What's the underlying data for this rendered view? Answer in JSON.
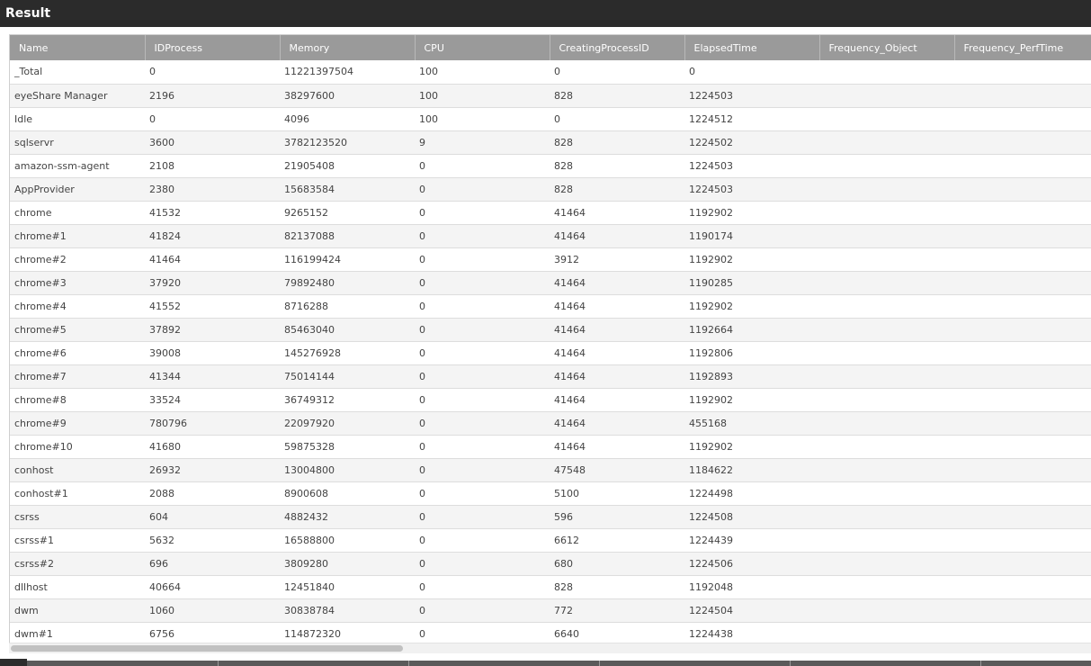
{
  "window": {
    "title": "Result"
  },
  "table": {
    "columns": [
      "Name",
      "IDProcess",
      "Memory",
      "CPU",
      "CreatingProcessID",
      "ElapsedTime",
      "Frequency_Object",
      "Frequency_PerfTime"
    ],
    "rows": [
      [
        "_Total",
        "0",
        "11221397504",
        "100",
        "0",
        "0",
        "",
        ""
      ],
      [
        "eyeShare Manager",
        "2196",
        "38297600",
        "100",
        "828",
        "1224503",
        "",
        ""
      ],
      [
        "Idle",
        "0",
        "4096",
        "100",
        "0",
        "1224512",
        "",
        ""
      ],
      [
        "sqlservr",
        "3600",
        "3782123520",
        "9",
        "828",
        "1224502",
        "",
        ""
      ],
      [
        "amazon-ssm-agent",
        "2108",
        "21905408",
        "0",
        "828",
        "1224503",
        "",
        ""
      ],
      [
        "AppProvider",
        "2380",
        "15683584",
        "0",
        "828",
        "1224503",
        "",
        ""
      ],
      [
        "chrome",
        "41532",
        "9265152",
        "0",
        "41464",
        "1192902",
        "",
        ""
      ],
      [
        "chrome#1",
        "41824",
        "82137088",
        "0",
        "41464",
        "1190174",
        "",
        ""
      ],
      [
        "chrome#2",
        "41464",
        "116199424",
        "0",
        "3912",
        "1192902",
        "",
        ""
      ],
      [
        "chrome#3",
        "37920",
        "79892480",
        "0",
        "41464",
        "1190285",
        "",
        ""
      ],
      [
        "chrome#4",
        "41552",
        "8716288",
        "0",
        "41464",
        "1192902",
        "",
        ""
      ],
      [
        "chrome#5",
        "37892",
        "85463040",
        "0",
        "41464",
        "1192664",
        "",
        ""
      ],
      [
        "chrome#6",
        "39008",
        "145276928",
        "0",
        "41464",
        "1192806",
        "",
        ""
      ],
      [
        "chrome#7",
        "41344",
        "75014144",
        "0",
        "41464",
        "1192893",
        "",
        ""
      ],
      [
        "chrome#8",
        "33524",
        "36749312",
        "0",
        "41464",
        "1192902",
        "",
        ""
      ],
      [
        "chrome#9",
        "780796",
        "22097920",
        "0",
        "41464",
        "455168",
        "",
        ""
      ],
      [
        "chrome#10",
        "41680",
        "59875328",
        "0",
        "41464",
        "1192902",
        "",
        ""
      ],
      [
        "conhost",
        "26932",
        "13004800",
        "0",
        "47548",
        "1184622",
        "",
        ""
      ],
      [
        "conhost#1",
        "2088",
        "8900608",
        "0",
        "5100",
        "1224498",
        "",
        ""
      ],
      [
        "csrss",
        "604",
        "4882432",
        "0",
        "596",
        "1224508",
        "",
        ""
      ],
      [
        "csrss#1",
        "5632",
        "16588800",
        "0",
        "6612",
        "1224439",
        "",
        ""
      ],
      [
        "csrss#2",
        "696",
        "3809280",
        "0",
        "680",
        "1224506",
        "",
        ""
      ],
      [
        "dllhost",
        "40664",
        "12451840",
        "0",
        "828",
        "1192048",
        "",
        ""
      ],
      [
        "dwm",
        "1060",
        "30838784",
        "0",
        "772",
        "1224504",
        "",
        ""
      ],
      [
        "dwm#1",
        "6756",
        "114872320",
        "0",
        "6640",
        "1224438",
        "",
        ""
      ]
    ]
  },
  "colors": {
    "titlebar": "#2b2b2b",
    "header": "#9a9a9a",
    "row_alt": "#f4f4f4"
  }
}
